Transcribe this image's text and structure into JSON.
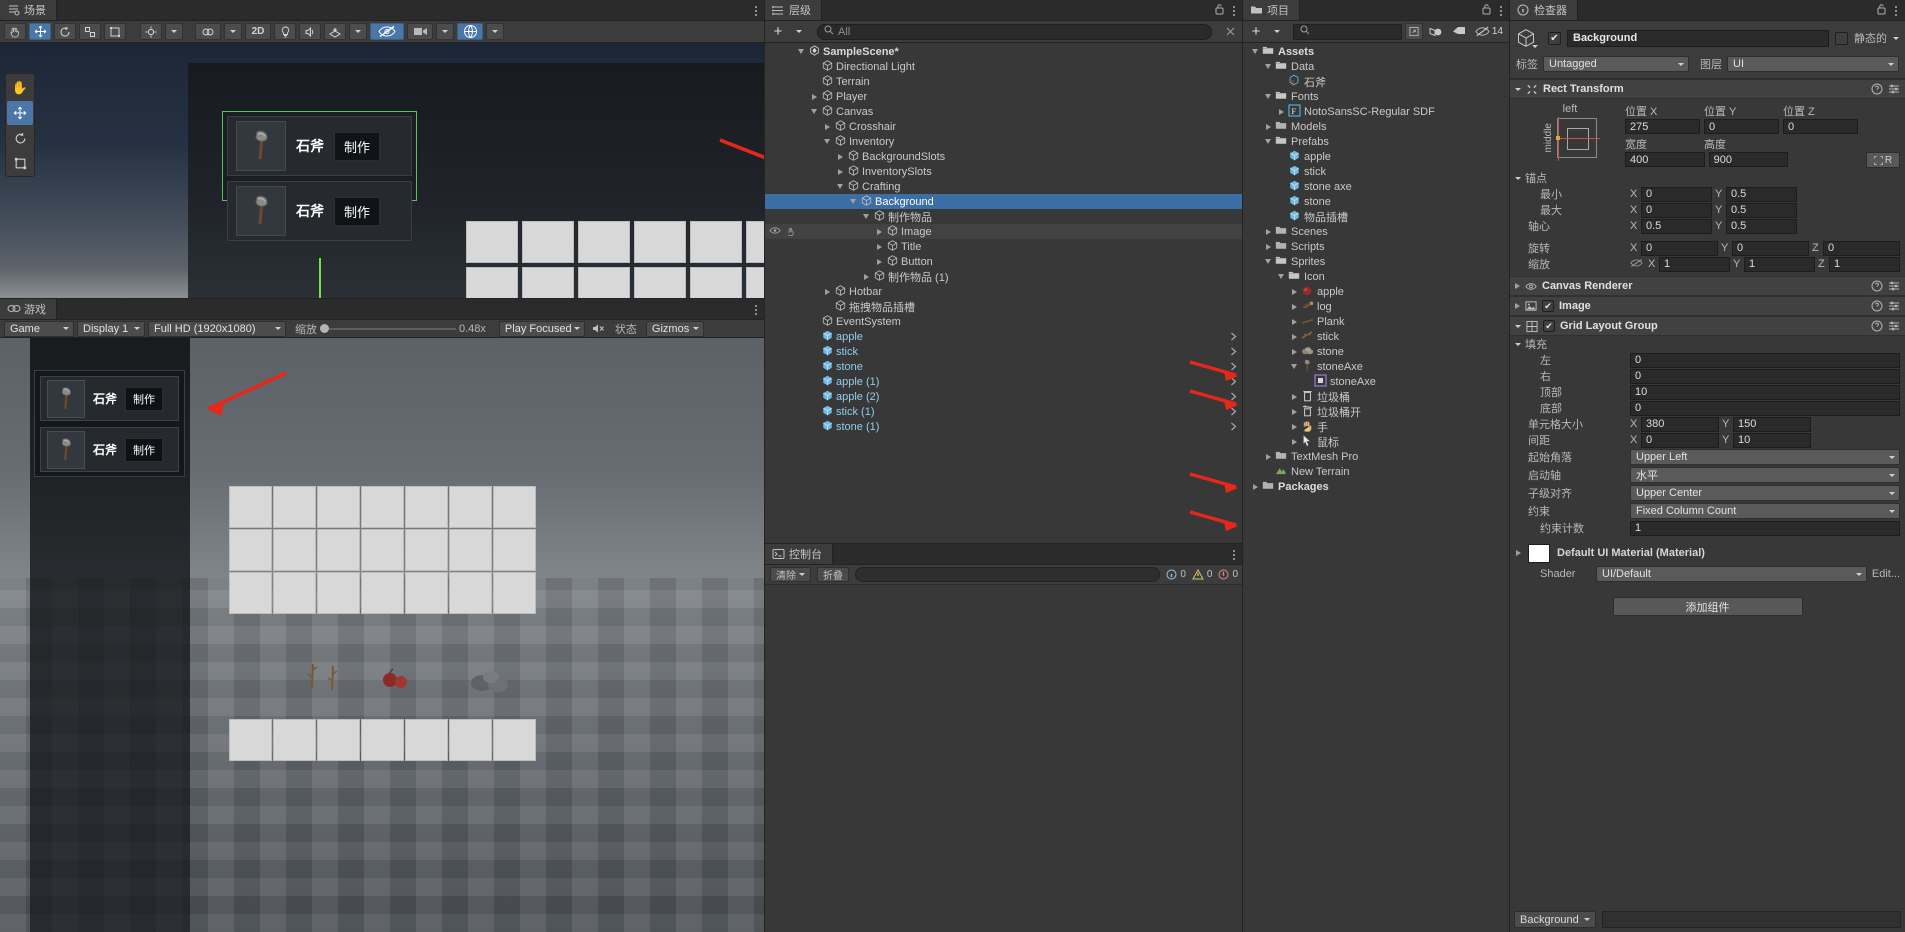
{
  "scene": {
    "tab_label": "场景",
    "tab_icon": "scene-icon",
    "toolbar": {
      "hand_tool": "hand-icon",
      "move_tool": "move-icon",
      "rotate_tool": "rotate-icon",
      "scale_tool": "scale-icon",
      "rect_tool": "rect-icon",
      "pivot_label": "pivot-icon",
      "shading_label": "shading-icon",
      "mode_2d": "2D",
      "light_icon": "light-icon",
      "audio_icon": "audio-icon",
      "fx_icon": "fx-icon",
      "hidden_icon": "visibility-off-icon",
      "camera_icon": "camera-icon",
      "gizmo_icon": "orientation-gizmo-icon"
    },
    "crafting_rows": [
      {
        "icon": "axe-icon",
        "name": "石斧",
        "button": "制作"
      },
      {
        "icon": "axe-icon",
        "name": "石斧",
        "button": "制作"
      }
    ]
  },
  "game": {
    "tab_label": "游戏",
    "tab_icon": "game-icon",
    "controls": {
      "play_mode": "Game",
      "display": "Display 1",
      "resolution": "Full HD (1920x1080)",
      "scale_label": "缩放",
      "scale_value": "0.48x",
      "play_focused": "Play Focused",
      "mute_icon": "mute-audio-icon",
      "stats_label": "状态",
      "gizmos_label": "Gizmos"
    },
    "crafting_rows": [
      {
        "icon": "axe-icon",
        "name": "石斧",
        "button": "制作"
      },
      {
        "icon": "axe-icon",
        "name": "石斧",
        "button": "制作"
      }
    ]
  },
  "hierarchy": {
    "tab_label": "层级",
    "tab_icon": "hierarchy-icon",
    "add_label": "+",
    "search_placeholder": "All",
    "search_icon": "search-icon",
    "items": [
      {
        "label": "SampleScene*",
        "depth": 0,
        "twirl": "open",
        "icon": "unity-icon",
        "kind": "scene"
      },
      {
        "label": "Directional Light",
        "depth": 1,
        "twirl": "none",
        "icon": "cube-icon",
        "kind": "go"
      },
      {
        "label": "Terrain",
        "depth": 1,
        "twirl": "none",
        "icon": "cube-icon",
        "kind": "go"
      },
      {
        "label": "Player",
        "depth": 1,
        "twirl": "closed",
        "icon": "cube-icon",
        "kind": "go"
      },
      {
        "label": "Canvas",
        "depth": 1,
        "twirl": "open",
        "icon": "cube-icon",
        "kind": "go"
      },
      {
        "label": "Crosshair",
        "depth": 2,
        "twirl": "closed",
        "icon": "cube-icon",
        "kind": "go"
      },
      {
        "label": "Inventory",
        "depth": 2,
        "twirl": "open",
        "icon": "cube-icon",
        "kind": "go"
      },
      {
        "label": "BackgroundSlots",
        "depth": 3,
        "twirl": "closed",
        "icon": "cube-icon",
        "kind": "go"
      },
      {
        "label": "InventorySlots",
        "depth": 3,
        "twirl": "closed",
        "icon": "cube-icon",
        "kind": "go"
      },
      {
        "label": "Crafting",
        "depth": 3,
        "twirl": "open",
        "icon": "cube-icon",
        "kind": "go"
      },
      {
        "label": "Background",
        "depth": 4,
        "twirl": "open",
        "icon": "cube-icon",
        "kind": "go",
        "selected": true
      },
      {
        "label": "制作物品",
        "depth": 5,
        "twirl": "open",
        "icon": "cube-icon",
        "kind": "go"
      },
      {
        "label": "Image",
        "depth": 6,
        "twirl": "closed",
        "icon": "cube-icon",
        "kind": "go",
        "hover": true
      },
      {
        "label": "Title",
        "depth": 6,
        "twirl": "closed",
        "icon": "cube-icon",
        "kind": "go"
      },
      {
        "label": "Button",
        "depth": 6,
        "twirl": "closed",
        "icon": "cube-icon",
        "kind": "go"
      },
      {
        "label": "制作物品 (1)",
        "depth": 5,
        "twirl": "closed",
        "icon": "cube-icon",
        "kind": "go"
      },
      {
        "label": "Hotbar",
        "depth": 2,
        "twirl": "closed",
        "icon": "cube-icon",
        "kind": "go"
      },
      {
        "label": "拖拽物品插槽",
        "depth": 2,
        "twirl": "none",
        "icon": "cube-icon",
        "kind": "go"
      },
      {
        "label": "EventSystem",
        "depth": 1,
        "twirl": "none",
        "icon": "cube-icon",
        "kind": "go"
      },
      {
        "label": "apple",
        "depth": 1,
        "twirl": "none",
        "icon": "prefab-icon",
        "kind": "prefab",
        "chev": true
      },
      {
        "label": "stick",
        "depth": 1,
        "twirl": "none",
        "icon": "prefab-icon",
        "kind": "prefab",
        "chev": true
      },
      {
        "label": "stone",
        "depth": 1,
        "twirl": "none",
        "icon": "prefab-icon",
        "kind": "prefab",
        "chev": true
      },
      {
        "label": "apple (1)",
        "depth": 1,
        "twirl": "none",
        "icon": "prefab-icon",
        "kind": "prefab",
        "chev": true
      },
      {
        "label": "apple (2)",
        "depth": 1,
        "twirl": "none",
        "icon": "prefab-icon",
        "kind": "prefab",
        "chev": true
      },
      {
        "label": "stick (1)",
        "depth": 1,
        "twirl": "none",
        "icon": "prefab-icon",
        "kind": "prefab",
        "chev": true
      },
      {
        "label": "stone (1)",
        "depth": 1,
        "twirl": "none",
        "icon": "prefab-icon",
        "kind": "prefab",
        "chev": true
      }
    ]
  },
  "console": {
    "tab_label": "控制台",
    "tab_icon": "console-icon",
    "clear_label": "清除",
    "collapse_label": "折叠",
    "counts": {
      "log": "0",
      "warn": "0",
      "error": "0"
    }
  },
  "project": {
    "tab_label": "项目",
    "tab_icon": "folder-icon",
    "add_label": "+",
    "search_placeholder": "",
    "search_icon": "search-icon",
    "save_search_icon": "save-search-icon",
    "lod_icon": "lod-icon",
    "label_icon": "label-icon",
    "hidden_icon": "visibility-off-icon",
    "hidden_count": "14",
    "items": [
      {
        "label": "Assets",
        "depth": 0,
        "twirl": "open",
        "icon": "folder-open-icon",
        "bold": true
      },
      {
        "label": "Data",
        "depth": 1,
        "twirl": "open",
        "icon": "folder-open-icon"
      },
      {
        "label": "石斧",
        "depth": 2,
        "twirl": "none",
        "icon": "scriptable-object-icon"
      },
      {
        "label": "Fonts",
        "depth": 1,
        "twirl": "open",
        "icon": "folder-open-icon"
      },
      {
        "label": "NotoSansSC-Regular SDF",
        "depth": 2,
        "twirl": "closed",
        "icon": "font-asset-icon"
      },
      {
        "label": "Models",
        "depth": 1,
        "twirl": "closed",
        "icon": "folder-icon"
      },
      {
        "label": "Prefabs",
        "depth": 1,
        "twirl": "open",
        "icon": "folder-open-icon"
      },
      {
        "label": "apple",
        "depth": 2,
        "twirl": "none",
        "icon": "prefab-icon"
      },
      {
        "label": "stick",
        "depth": 2,
        "twirl": "none",
        "icon": "prefab-icon"
      },
      {
        "label": "stone axe",
        "depth": 2,
        "twirl": "none",
        "icon": "prefab-icon"
      },
      {
        "label": "stone",
        "depth": 2,
        "twirl": "none",
        "icon": "prefab-icon"
      },
      {
        "label": "物品插槽",
        "depth": 2,
        "twirl": "none",
        "icon": "prefab-icon"
      },
      {
        "label": "Scenes",
        "depth": 1,
        "twirl": "closed",
        "icon": "folder-icon"
      },
      {
        "label": "Scripts",
        "depth": 1,
        "twirl": "closed",
        "icon": "folder-icon"
      },
      {
        "label": "Sprites",
        "depth": 1,
        "twirl": "open",
        "icon": "folder-open-icon"
      },
      {
        "label": "Icon",
        "depth": 2,
        "twirl": "open",
        "icon": "folder-open-icon"
      },
      {
        "label": "apple",
        "depth": 3,
        "twirl": "closed",
        "icon": "sprite-apple-icon"
      },
      {
        "label": "log",
        "depth": 3,
        "twirl": "closed",
        "icon": "sprite-log-icon"
      },
      {
        "label": "Plank",
        "depth": 3,
        "twirl": "closed",
        "icon": "sprite-plank-icon"
      },
      {
        "label": "stick",
        "depth": 3,
        "twirl": "closed",
        "icon": "sprite-stick-icon"
      },
      {
        "label": "stone",
        "depth": 3,
        "twirl": "closed",
        "icon": "sprite-stone-icon"
      },
      {
        "label": "stoneAxe",
        "depth": 3,
        "twirl": "open",
        "icon": "sprite-axe-icon"
      },
      {
        "label": "stoneAxe",
        "depth": 4,
        "twirl": "none",
        "icon": "sprite-sub-icon"
      },
      {
        "label": "垃圾桶",
        "depth": 3,
        "twirl": "closed",
        "icon": "sprite-trash-icon"
      },
      {
        "label": "垃圾桶开",
        "depth": 3,
        "twirl": "closed",
        "icon": "sprite-trash-open-icon"
      },
      {
        "label": "手",
        "depth": 3,
        "twirl": "closed",
        "icon": "sprite-hand-icon"
      },
      {
        "label": "鼠标",
        "depth": 3,
        "twirl": "closed",
        "icon": "sprite-cursor-icon"
      },
      {
        "label": "TextMesh Pro",
        "depth": 1,
        "twirl": "closed",
        "icon": "folder-icon"
      },
      {
        "label": "New Terrain",
        "depth": 1,
        "twirl": "none",
        "icon": "terrain-icon"
      },
      {
        "label": "Packages",
        "depth": 0,
        "twirl": "closed",
        "icon": "folder-icon",
        "bold": true
      }
    ]
  },
  "inspector": {
    "tab_label": "检查器",
    "tab_icon": "info-icon",
    "lock_icon": "lock-icon",
    "object": {
      "icon": "cube-icon",
      "enabled": true,
      "name": "Background",
      "static_label": "静态的",
      "static_checked": false,
      "tag_label": "标签",
      "tag_value": "Untagged",
      "layer_label": "图层",
      "layer_value": "UI"
    },
    "rect_transform": {
      "title": "Rect Transform",
      "icon": "rect-transform-icon",
      "anchor_preset_h": "left",
      "anchor_preset_v": "middle",
      "pos_x_label": "位置 X",
      "pos_y_label": "位置 Y",
      "pos_z_label": "位置 Z",
      "pos_x": "275",
      "pos_y": "0",
      "pos_z": "0",
      "width_label": "宽度",
      "height_label": "高度",
      "width": "400",
      "height": "900",
      "blueprint_label": "R",
      "anchors_label": "锚点",
      "min_label": "最小",
      "max_label": "最大",
      "min_x": "0",
      "min_y": "0.5",
      "max_x": "0",
      "max_y": "0.5",
      "pivot_label": "轴心",
      "pivot_x": "0.5",
      "pivot_y": "0.5",
      "rotation_label": "旋转",
      "rot_x": "0",
      "rot_y": "0",
      "rot_z": "0",
      "scale_label": "缩放",
      "scale_x": "1",
      "scale_y": "1",
      "scale_z": "1"
    },
    "canvas_renderer": {
      "title": "Canvas Renderer",
      "icon": "eye-icon"
    },
    "image": {
      "title": "Image",
      "icon": "image-icon",
      "enabled": true
    },
    "grid_layout_group": {
      "title": "Grid Layout Group",
      "icon": "grid-icon",
      "enabled": true,
      "padding_label": "填充",
      "left_label": "左",
      "left": "0",
      "right_label": "右",
      "right": "0",
      "top_label": "顶部",
      "top": "10",
      "bottom_label": "底部",
      "bottom": "0",
      "cell_size_label": "单元格大小",
      "cell_x": "380",
      "cell_y": "150",
      "spacing_label": "间距",
      "spacing_x": "0",
      "spacing_y": "10",
      "start_corner_label": "起始角落",
      "start_corner": "Upper Left",
      "start_axis_label": "启动轴",
      "start_axis": "水平",
      "child_alignment_label": "子级对齐",
      "child_alignment": "Upper Center",
      "constraint_label": "约束",
      "constraint": "Fixed Column Count",
      "constraint_count_label": "约束计数",
      "constraint_count": "1"
    },
    "material": {
      "name": "Default UI Material (Material)",
      "shader_label": "Shader",
      "shader_value": "UI/Default",
      "edit_label": "Edit..."
    },
    "add_component_label": "添加组件",
    "footer_dropdown": "Background"
  },
  "colors": {
    "accent_blue": "#3a6ea5",
    "toolbar_on": "#4a76a8",
    "arrow_red": "#e8271b",
    "prefab_blue": "#8fcdf0",
    "panel_bg": "#383838",
    "header_bg": "#3c3c3c",
    "field_bg": "#2a2a2a"
  }
}
